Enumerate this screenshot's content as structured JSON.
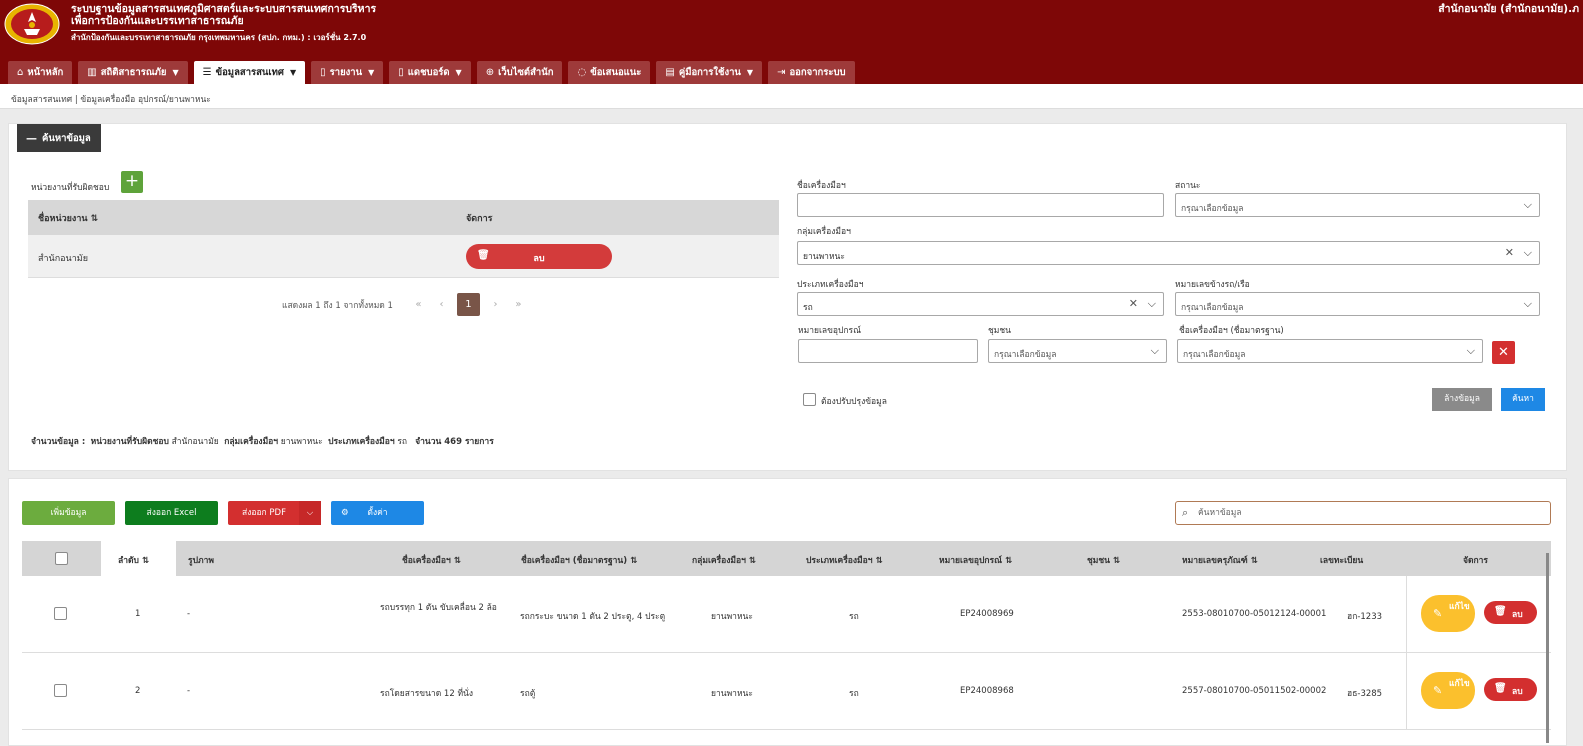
{
  "header": {
    "title_line1": "ระบบฐานข้อมูลสารสนเทศภูมิศาสตร์และระบบสารสนเทศการบริหาร",
    "title_line2": "เพื่อการป้องกันและบรรเทาสาธารณภัย",
    "subtitle": "สำนักป้องกันและบรรเทาสาธารณภัย กรุงเทพมหานคร (สปภ. กทม.) : เวอร์ชั่น 2.7.0",
    "user": "สำนักอนามัย (สำนักอนามัย).ภ",
    "logo_icon": "fire-department-emblem"
  },
  "nav": {
    "tabs": [
      {
        "icon": "⌂",
        "label": "หน้าหลัก",
        "dropdown": false
      },
      {
        "icon": "▥",
        "label": "สถิติสาธารณภัย",
        "dropdown": true
      },
      {
        "icon": "☰",
        "label": "ข้อมูลสารสนเทศ",
        "dropdown": true,
        "active": true
      },
      {
        "icon": "▯",
        "label": "รายงาน",
        "dropdown": true
      },
      {
        "icon": "▯",
        "label": "แดชบอร์ด",
        "dropdown": true
      },
      {
        "icon": "⊕",
        "label": "เว็บไซต์สำนัก",
        "dropdown": false
      },
      {
        "icon": "◌",
        "label": "ข้อเสนอแนะ",
        "dropdown": false
      },
      {
        "icon": "▤",
        "label": "คู่มือการใช้งาน",
        "dropdown": true
      },
      {
        "icon": "⇥",
        "label": "ออกจากระบบ",
        "dropdown": false
      }
    ]
  },
  "breadcrumb": "ข้อมูลสารสนเทศ | ข้อมูลเครื่องมือ อุปกรณ์/ยานพาหนะ",
  "search": {
    "toggle_label": "ค้นหาข้อมูล",
    "responsible_label": "หน่วยงานที่รับผิดชอบ",
    "add_icon": "+",
    "resp_table": {
      "headers": [
        "ชื่อหน่วยงาน ⇅",
        "จัดการ"
      ],
      "rows": [
        {
          "name": "สำนักอนามัย",
          "delete_label": "ลบ"
        }
      ]
    },
    "pager": {
      "info": "แสดงผล 1 ถึง 1 จากทั้งหมด 1",
      "first": "«",
      "prev": "‹",
      "current": "1",
      "next": "›",
      "last": "»"
    },
    "fields": {
      "tool_name": {
        "label": "ชื่อเครื่องมือฯ",
        "value": ""
      },
      "status": {
        "label": "สถานะ",
        "placeholder": "กรุณาเลือกข้อมูล"
      },
      "tool_group": {
        "label": "กลุ่มเครื่องมือฯ",
        "value": "ยานพาหนะ"
      },
      "tool_type": {
        "label": "ประเภทเครื่องมือฯ",
        "value": "รถ"
      },
      "side_number": {
        "label": "หมายเลขข้างรถ/เรือ",
        "placeholder": "กรุณาเลือกข้อมูล"
      },
      "equipment_no": {
        "label": "หมายเลขอุปกรณ์",
        "value": ""
      },
      "community": {
        "label": "ชุมชน",
        "placeholder": "กรุณาเลือกข้อมูล"
      },
      "standard_name": {
        "label": "ชื่อเครื่องมือฯ (ชื่อมาตรฐาน)",
        "placeholder": "กรุณาเลือกข้อมูล"
      }
    },
    "improve_label": "ต้องปรับปรุงข้อมูล",
    "clear_label": "ล้างข้อมูล",
    "search_label": "ค้นหา",
    "summary": {
      "prefix": "จำนวนข้อมูล :",
      "resp_key": "หน่วยงานที่รับผิดชอบ",
      "resp_val": "สำนักอนามัย",
      "group_key": "กลุ่มเครื่องมือฯ",
      "group_val": "ยานพาหนะ",
      "type_key": "ประเภทเครื่องมือฯ",
      "type_val": "รถ",
      "count": "จำนวน 469 รายการ"
    }
  },
  "results": {
    "add_label": "เพิ่มข้อมูล",
    "excel_label": "ส่งออก Excel",
    "pdf_label": "ส่งออก PDF",
    "settings_label": "ตั้งค่า",
    "search_placeholder": "ค้นหาข้อมูล",
    "columns": {
      "seq": "ลำดับ ⇅",
      "image": "รูปภาพ",
      "name": "ชื่อเครื่องมือฯ ⇅",
      "std_name": "ชื่อเครื่องมือฯ (ชื่อมาตรฐาน) ⇅",
      "group": "กลุ่มเครื่องมือฯ ⇅",
      "type": "ประเภทเครื่องมือฯ ⇅",
      "equip_no": "หมายเลขอุปกรณ์ ⇅",
      "community": "ชุมชน ⇅",
      "asset_no": "หมายเลขครุภัณฑ์ ⇅",
      "plate": "เลขทะเบียน",
      "manage": "จัดการ"
    },
    "rows": [
      {
        "seq": "1",
        "image": "-",
        "name": "รถบรรทุก 1 ตัน ขับเคลื่อน 2 ล้อ",
        "std_name": "รถกระบะ ขนาด 1 ตัน 2 ประตู, 4 ประตู",
        "group": "ยานพาหนะ",
        "type": "รถ",
        "equip_no": "EP24008969",
        "community": "",
        "asset_no": "2553-08010700-05012124-00001",
        "plate": "ฮก-1233",
        "edit_label": "แก้ไข",
        "delete_label": "ลบ"
      },
      {
        "seq": "2",
        "image": "-",
        "name": "รถโดยสารขนาด 12 ที่นั่ง",
        "std_name": "รถตู้",
        "group": "ยานพาหนะ",
        "type": "รถ",
        "equip_no": "EP24008968",
        "community": "",
        "asset_no": "2557-08010700-05011502-00002",
        "plate": "ฮธ-3285",
        "edit_label": "แก้ไข",
        "delete_label": "ลบ"
      }
    ]
  },
  "colors": {
    "header_bg": "#7e0707",
    "tab_bg": "#9e3a3a",
    "add_green": "#6cac3e",
    "excel_green": "#0d7d1e",
    "danger": "#d32f2f",
    "primary": "#1e88e5",
    "warning": "#fbc02d",
    "page_active": "#795548"
  }
}
